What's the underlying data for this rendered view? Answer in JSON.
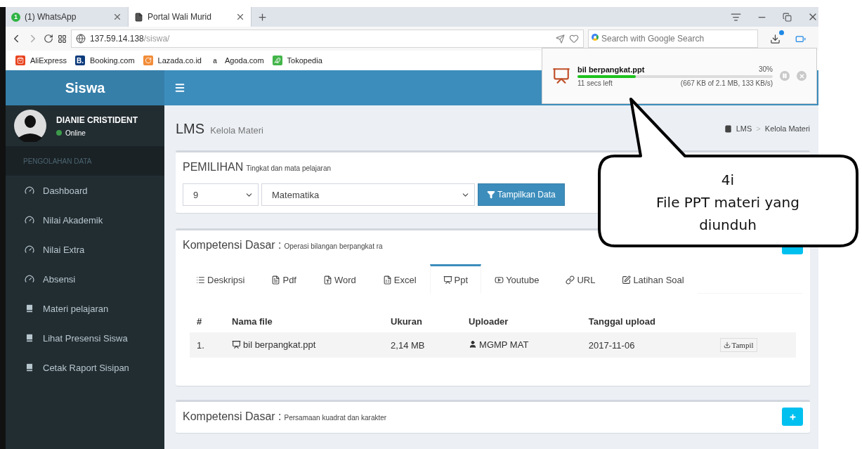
{
  "browser": {
    "tabs": [
      {
        "title": "(1) WhatsApp",
        "badge": "1",
        "kind": "whatsapp",
        "selected": false
      },
      {
        "title": "Portal Wali Murid",
        "kind": "page",
        "selected": true
      }
    ],
    "url": {
      "host": "137.59.14.138",
      "path": "/siswa/"
    },
    "search": {
      "placeholder": "Search with Google Search"
    },
    "bookmarks": [
      {
        "label": "AliExpress",
        "kind": "bag",
        "color": "#e8431f"
      },
      {
        "label": "Booking.com",
        "kind": "letter",
        "logo": "B.",
        "color": "#0c3b7c"
      },
      {
        "label": "Lazada.co.id",
        "kind": "swirl",
        "color": "#f28c38"
      },
      {
        "label": "Agoda.com",
        "kind": "letter",
        "logo": "a",
        "color": "#ffffff"
      },
      {
        "label": "Tokopedia",
        "kind": "owl",
        "color": "#42b549"
      }
    ]
  },
  "download": {
    "filename": "bil berpangkat.ppt",
    "percent": "30%",
    "level": 0.3,
    "time_left": "11 secs left",
    "detail": "(667 KB of 2.1 MB, 133 KB/s)"
  },
  "app": {
    "brand": "Siswa",
    "user": {
      "name": "DIANIE CRISTIDENT",
      "status": "Online"
    },
    "sidebar": {
      "header": "PENGOLAHAN DATA",
      "items": [
        {
          "label": "Dashboard",
          "kind": "gauge"
        },
        {
          "label": "Nilai Akademik",
          "kind": "gauge"
        },
        {
          "label": "Nilai Extra",
          "kind": "gauge"
        },
        {
          "label": "Absensi",
          "kind": "gauge"
        },
        {
          "label": "Materi pelajaran",
          "kind": "book"
        },
        {
          "label": "Lihat Presensi Siswa",
          "kind": "book"
        },
        {
          "label": "Cetak Raport Sisipan",
          "kind": "book"
        }
      ]
    },
    "page": {
      "title": "LMS",
      "subtitle": "Kelola Materi",
      "breadcrumb": [
        "LMS",
        "Kelola Materi"
      ],
      "separator": ">"
    },
    "selection": {
      "title": "PEMILIHAN",
      "subtitle": "Tingkat dan mata pelajaran",
      "grade": "9",
      "subject": "Matematika",
      "button": "Tampilkan Data"
    },
    "competencies": [
      {
        "title": "Kompetensi Dasar :",
        "subtitle": "Operasi bilangan berpangkat ra",
        "expanded": true,
        "tabs": [
          {
            "label": "Deskripsi",
            "kind": "list",
            "selected": false
          },
          {
            "label": "Pdf",
            "kind": "pdf",
            "selected": false
          },
          {
            "label": "Word",
            "kind": "word",
            "selected": false
          },
          {
            "label": "Excel",
            "kind": "excel",
            "selected": false
          },
          {
            "label": "Ppt",
            "kind": "ppt",
            "selected": true
          },
          {
            "label": "Youtube",
            "kind": "youtube",
            "selected": false
          },
          {
            "label": "URL",
            "kind": "link",
            "selected": false
          },
          {
            "label": "Latihan Soal",
            "kind": "edit",
            "selected": false
          }
        ],
        "table": {
          "columns": [
            "#",
            "Nama file",
            "Ukuran",
            "Uploader",
            "Tanggal upload"
          ],
          "rows": [
            {
              "no": "1.",
              "file": "bil berpangkat.ppt",
              "size": "2,14 MB",
              "uploader": "MGMP MAT",
              "date": "2017-11-06",
              "action": "Tampil"
            }
          ]
        }
      },
      {
        "title": "Kompetensi Dasar :",
        "subtitle": "Persamaan kuadrat dan karakter",
        "expanded": false
      }
    ]
  },
  "callout": {
    "number": "4i",
    "text": "File PPT materi yang diunduh"
  }
}
